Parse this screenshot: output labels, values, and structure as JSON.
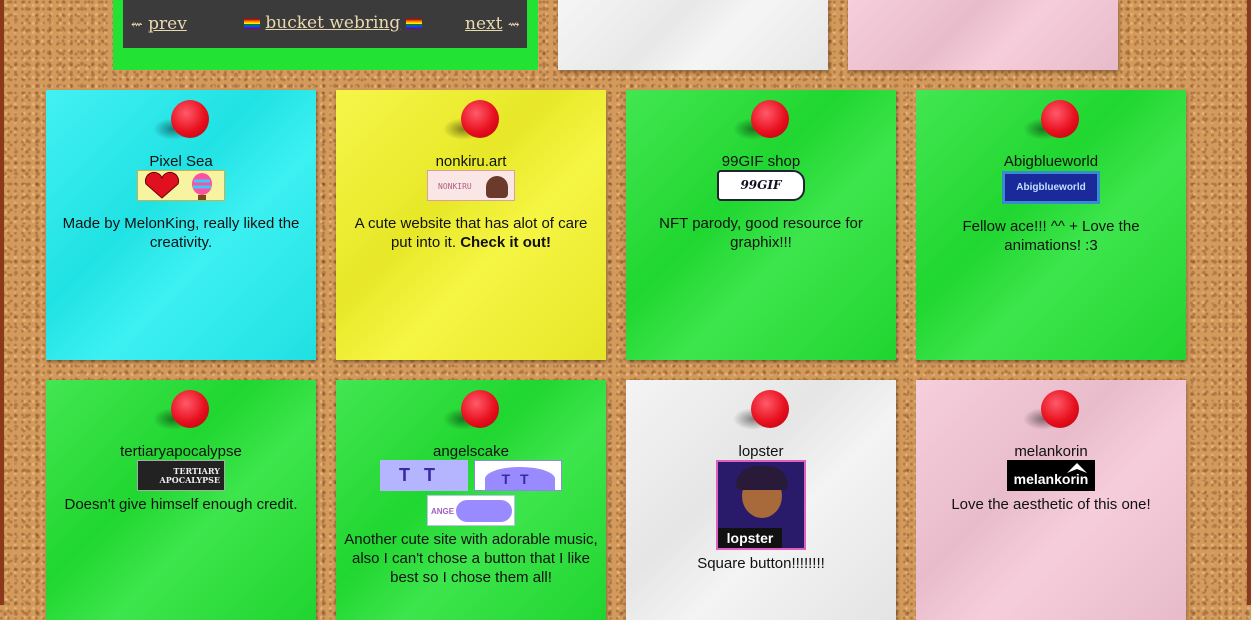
{
  "webring": {
    "prev_arrow": "⇜",
    "prev_label": "prev",
    "title": "bucket webring",
    "next_label": "next",
    "next_arrow": "⇝"
  },
  "notes": [
    {
      "name": "Pixel Sea",
      "desc": "Made by MelonKing, really liked the creativity.",
      "color": "#22eef0"
    },
    {
      "name": "nonkiru.art",
      "desc_plain": "A cute website that has alot of care put into it.",
      "desc_bold": "Check it out!",
      "color": "#f4f42a",
      "button_text": "NONKIRU"
    },
    {
      "name": "99GIF shop",
      "desc": "NFT parody, good resource for graphix!!!",
      "color": "#22e233",
      "button_text": "99GIF SHOP"
    },
    {
      "name": "Abigblueworld",
      "desc": "Fellow ace!!! ^^ + Love the animations! :3",
      "color": "#22e233",
      "button_text": "Abigblueworld"
    },
    {
      "name": "tertiaryapocalypse",
      "desc": "Doesn't give himself enough credit.",
      "color": "#22e233",
      "button_text": "TERTIARY APOCALYPSE"
    },
    {
      "name": "angelscake",
      "desc": "Another cute site with adorable music, also I can't chose a button that I like best so I chose them all!",
      "color": "#22e233",
      "button_text": "ANGE"
    },
    {
      "name": "lopster",
      "desc": "Square button!!!!!!!!",
      "color": "#f2f2f2",
      "button_text": "lopster"
    },
    {
      "name": "melankorin",
      "desc": "Love the aesthetic of this one!",
      "color": "#f5c6d6",
      "button_text": "melankorin"
    }
  ],
  "top_notes": [
    {
      "color": "#f4f4f4"
    },
    {
      "color": "#f5c6d6"
    }
  ]
}
